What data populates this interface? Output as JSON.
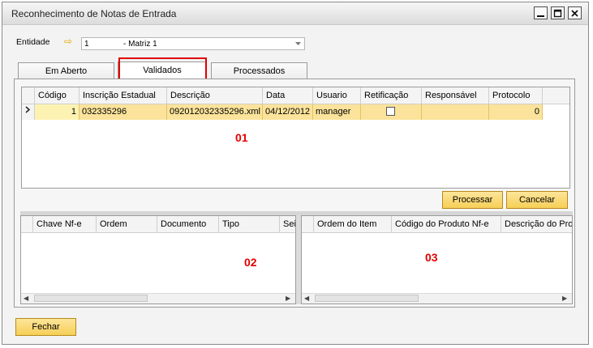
{
  "window": {
    "title": "Reconhecimento de Notas de Entrada"
  },
  "entidade": {
    "label": "Entidade",
    "code": "1",
    "name": "- Matriz 1"
  },
  "tabs": [
    {
      "label": "Em Aberto"
    },
    {
      "label": "Validados"
    },
    {
      "label": "Processados"
    }
  ],
  "grid1": {
    "columns": [
      "Código",
      "Inscrição Estadual",
      "Descrição",
      "Data",
      "Usuario",
      "Retificação",
      "Responsável",
      "Protocolo"
    ],
    "row": {
      "codigo": "1",
      "inscricao": "032335296",
      "descricao": "092012032335296.xml",
      "data": "04/12/2012",
      "usuario": "manager",
      "retificacao": false,
      "responsavel": "",
      "protocolo": "0"
    },
    "annotation": "01"
  },
  "buttons": {
    "processar": "Processar",
    "cancelar": "Cancelar",
    "fechar": "Fechar"
  },
  "grid2": {
    "columns": [
      "Chave Nf-e",
      "Ordem",
      "Documento",
      "Tipo",
      "Sei"
    ],
    "annotation": "02"
  },
  "grid3": {
    "columns": [
      "Ordem do Item",
      "Código do Produto Nf-e",
      "Descrição do Pro"
    ],
    "annotation": "03"
  }
}
